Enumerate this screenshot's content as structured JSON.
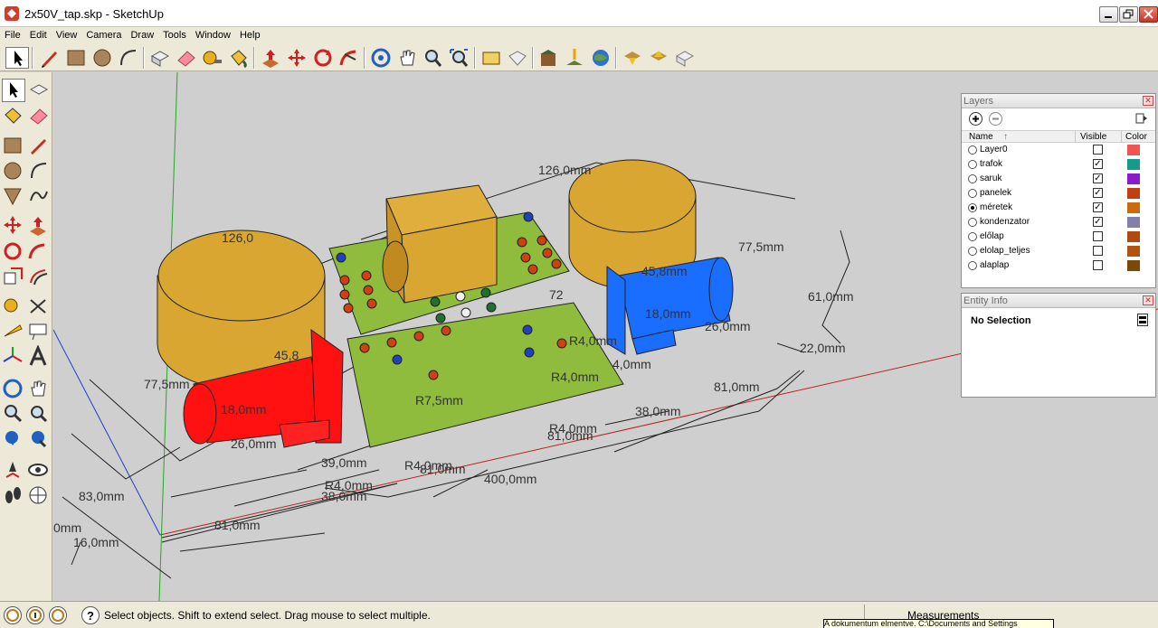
{
  "window": {
    "title": "2x50V_tap.skp - SketchUp",
    "accent": "#c0392b"
  },
  "menu": [
    "File",
    "Edit",
    "View",
    "Camera",
    "Draw",
    "Tools",
    "Window",
    "Help"
  ],
  "toolbar_icons": [
    "select-arrow-icon",
    "pencil-icon",
    "rectangle-icon",
    "circle-icon",
    "arc-icon",
    "make-component-icon",
    "eraser-icon",
    "tape-measure-icon",
    "paint-bucket-icon",
    "push-pull-icon",
    "move-icon",
    "rotate-icon",
    "follow-me-icon",
    "orbit-icon",
    "pan-icon",
    "zoom-icon",
    "zoom-extents-icon",
    "get-models-icon",
    "share-model-icon",
    "add-location-icon",
    "toggle-terrain-icon",
    "google-earth-icon",
    "previous-view-icon",
    "next-view-icon",
    "standard-views-icon"
  ],
  "left_tools": [
    "select-icon",
    "make-component-icon",
    "paint-bucket-icon",
    "eraser-icon",
    "rectangle-icon",
    "line-icon",
    "circle-icon",
    "arc-icon",
    "polygon-icon",
    "freehand-icon",
    "move-icon",
    "push-pull-icon",
    "rotate-icon",
    "follow-me-icon",
    "scale-icon",
    "offset-icon",
    "tape-measure-icon",
    "dimension-icon",
    "protractor-icon",
    "text-icon",
    "axes-icon",
    "3d-text-icon",
    "orbit-icon",
    "pan-icon",
    "zoom-icon",
    "zoom-window-icon",
    "previous-icon",
    "zoom-extents-icon",
    "position-camera-icon",
    "look-around-icon",
    "walk-icon",
    "section-plane-icon"
  ],
  "layers_panel": {
    "title": "Layers",
    "col_name": "Name",
    "col_visible": "Visible",
    "col_color": "Color",
    "layers": [
      {
        "name": "Layer0",
        "active": false,
        "visible": false,
        "color": "#ee5555"
      },
      {
        "name": "trafok",
        "active": false,
        "visible": true,
        "color": "#169a8c"
      },
      {
        "name": "saruk",
        "active": false,
        "visible": true,
        "color": "#8a1ccc"
      },
      {
        "name": "panelek",
        "active": false,
        "visible": true,
        "color": "#c04010"
      },
      {
        "name": "méretek",
        "active": true,
        "visible": true,
        "color": "#cc6a10"
      },
      {
        "name": "kondenzator",
        "active": false,
        "visible": true,
        "color": "#8080a8"
      },
      {
        "name": "előlap",
        "active": false,
        "visible": false,
        "color": "#b04a10"
      },
      {
        "name": "elolap_teljes",
        "active": false,
        "visible": false,
        "color": "#b05510"
      },
      {
        "name": "alaplap",
        "active": false,
        "visible": false,
        "color": "#7a4808"
      }
    ]
  },
  "entity_panel": {
    "title": "Entity Info",
    "selection": "No Selection"
  },
  "status": {
    "message": "Select objects. Shift to extend select. Drag mouse to select multiple.",
    "measurements_label": "Measurements",
    "tooltip": "A dokumentum elmentve. C:\\Documents and Settings"
  },
  "dimensions": {
    "d126a": "126,0mm",
    "d126b": "126,0",
    "d775a": "77,5mm",
    "d775b": "77,5mm",
    "d61": "61,0mm",
    "d22": "22,0mm",
    "d458a": "45,8mm",
    "d458b": "45,8",
    "d18a": "18,0mm",
    "d18b": "18,0mm",
    "d26a": "26,0mm",
    "d26b": "26,0mm",
    "dr4a": "R4,0mm",
    "dr4b": "R4,0mm",
    "dr4c": "R4,0mm",
    "dr4d": "R4,0mm",
    "dr4e": "R4,0mm",
    "dr75": "R7,5mm",
    "d81a": "81,0mm",
    "d81b": "81,0mm",
    "d81c": "81,0mm",
    "d81d": "81,0mm",
    "d38a": "38,0mm",
    "d38b": "38,0mm",
    "d39": "39,0mm",
    "d400": "400,0mm",
    "d83": "83,0mm",
    "d16": "16,0mm",
    "d0": "0mm",
    "d72": "72",
    "d40": "4,0mm"
  },
  "colors": {
    "transformer": "#d9a731",
    "pcb": "#8fbc3c",
    "motor_red": "#ff1111",
    "motor_blue": "#1a6eff",
    "viewport": "#cfcfcf"
  }
}
